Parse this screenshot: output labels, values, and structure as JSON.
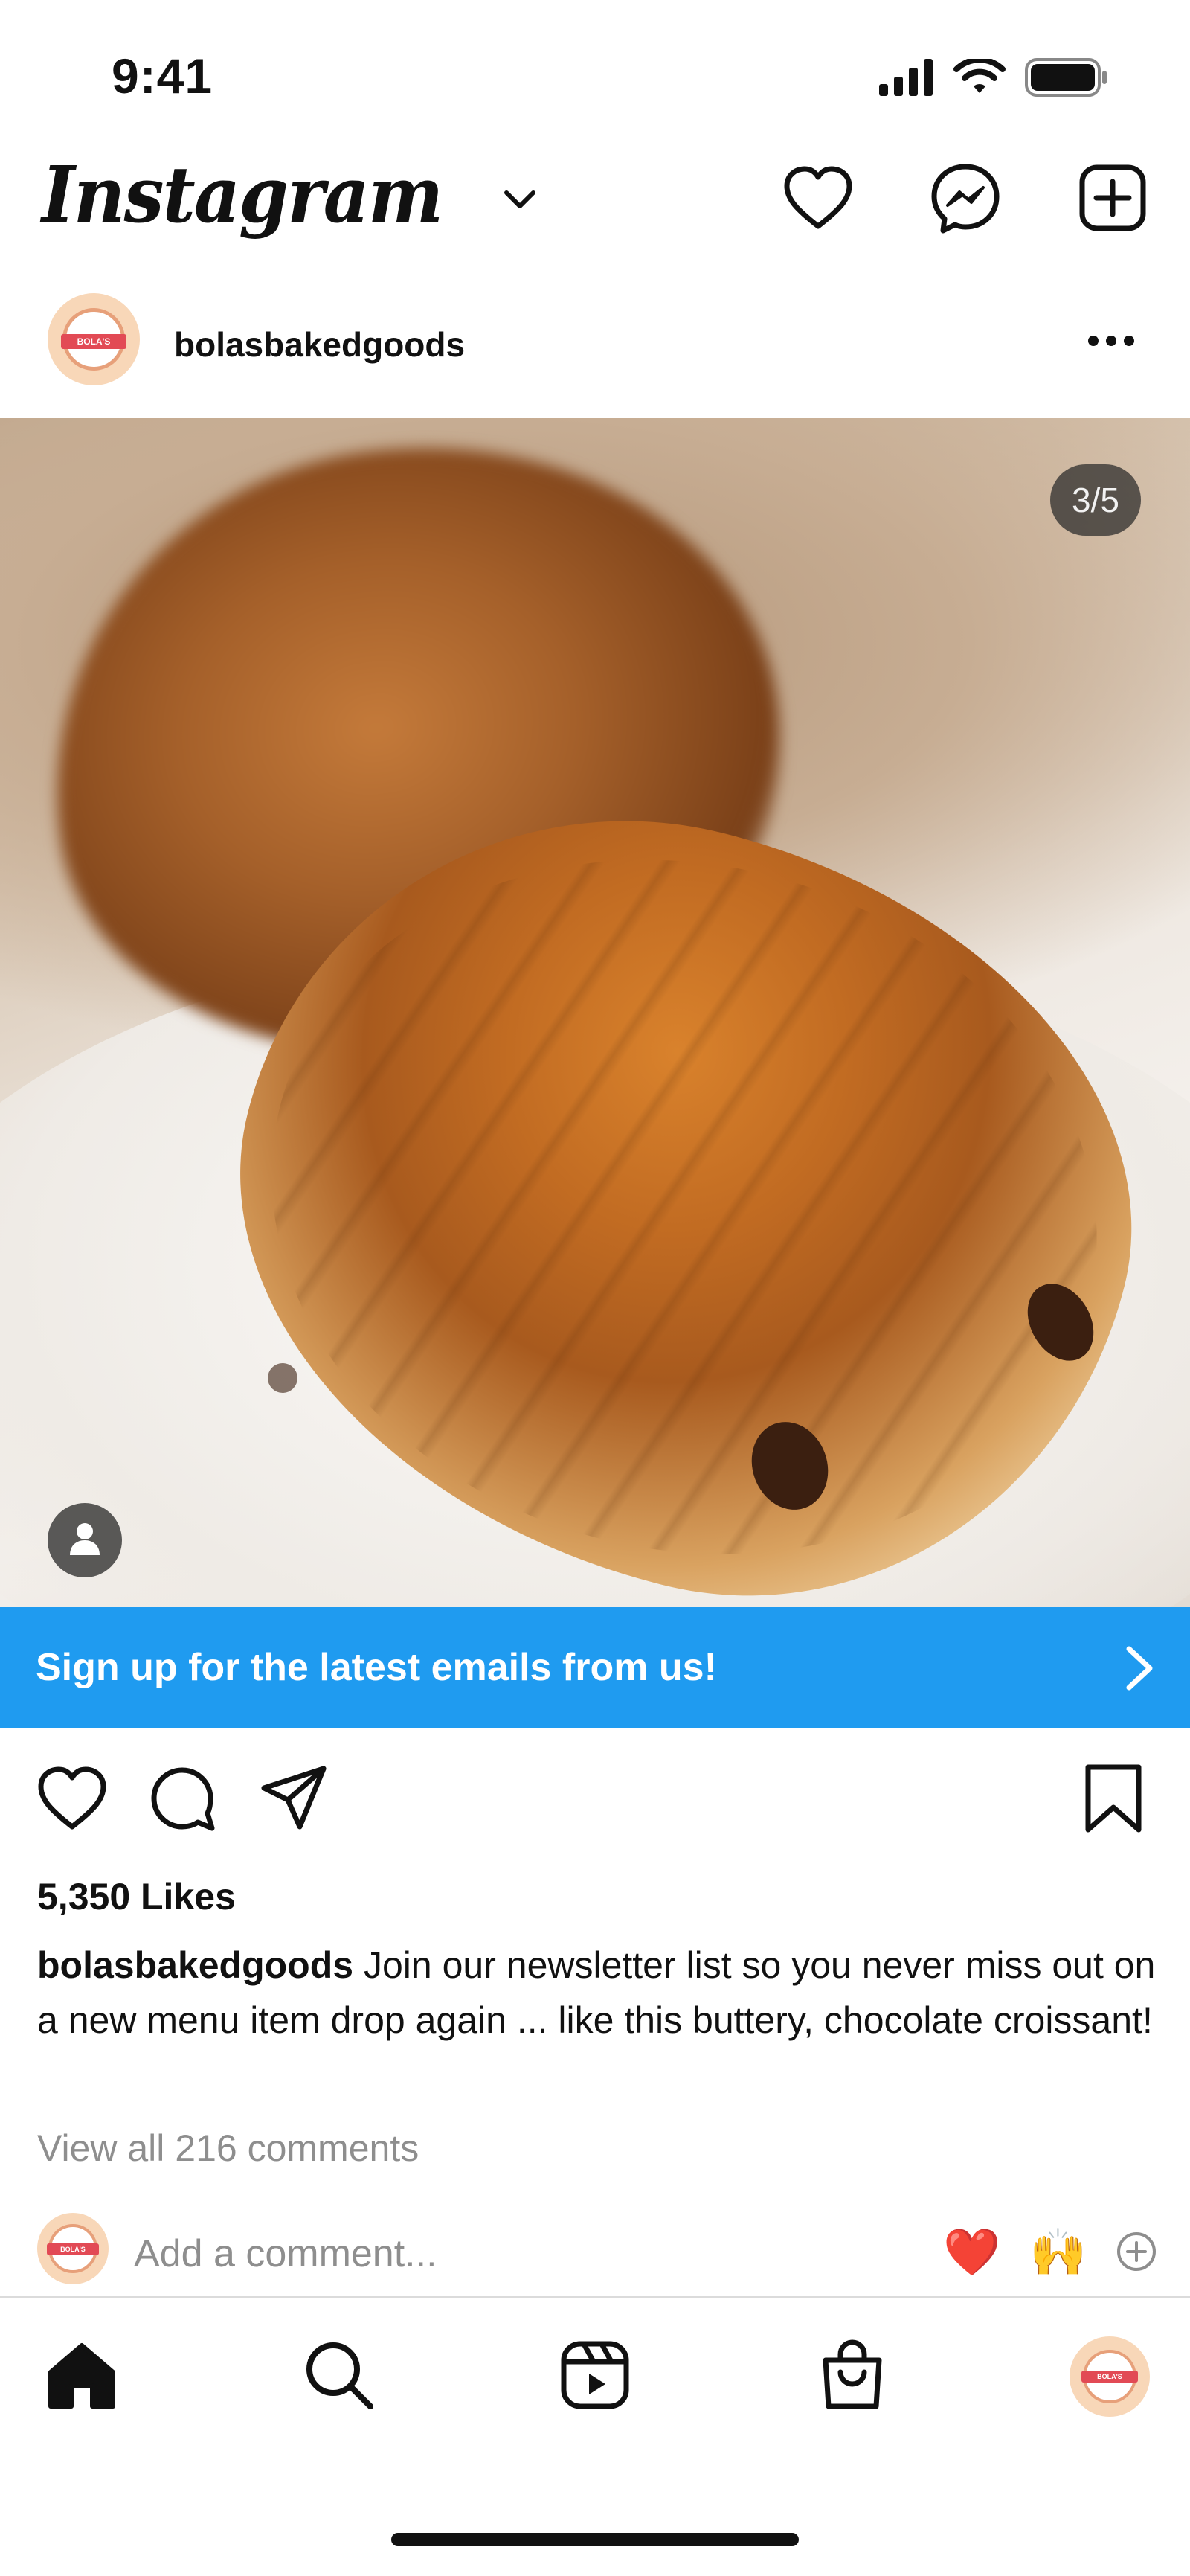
{
  "status_bar": {
    "time": "9:41",
    "icons": [
      "signal-icon",
      "wifi-icon",
      "battery-icon"
    ]
  },
  "header": {
    "brand": "Instagram",
    "actions": [
      "heart-icon",
      "messenger-icon",
      "new-post-icon"
    ]
  },
  "post": {
    "username": "bolasbakedgoods",
    "avatar_text": "BOLA'S",
    "image_counter": "3/5",
    "cta_text": "Sign up for the latest emails from us!",
    "likes": "5,350 Likes",
    "caption": "Join our newsletter list so you never miss out on a new menu item drop again ... like this buttery, chocolate croissant!",
    "view_comments": "View all 216 comments"
  },
  "comment_box": {
    "placeholder": "Add a comment...",
    "quick_emojis": [
      "❤️",
      "🙌"
    ]
  },
  "tab_bar": {
    "tabs": [
      "home-icon",
      "search-icon",
      "reels-icon",
      "shop-icon",
      "profile-avatar"
    ]
  },
  "colors": {
    "cta_blue": "#1f9bf0",
    "text": "#111111",
    "muted": "#8e8e8e",
    "emoji_heart": "#e0141e"
  }
}
